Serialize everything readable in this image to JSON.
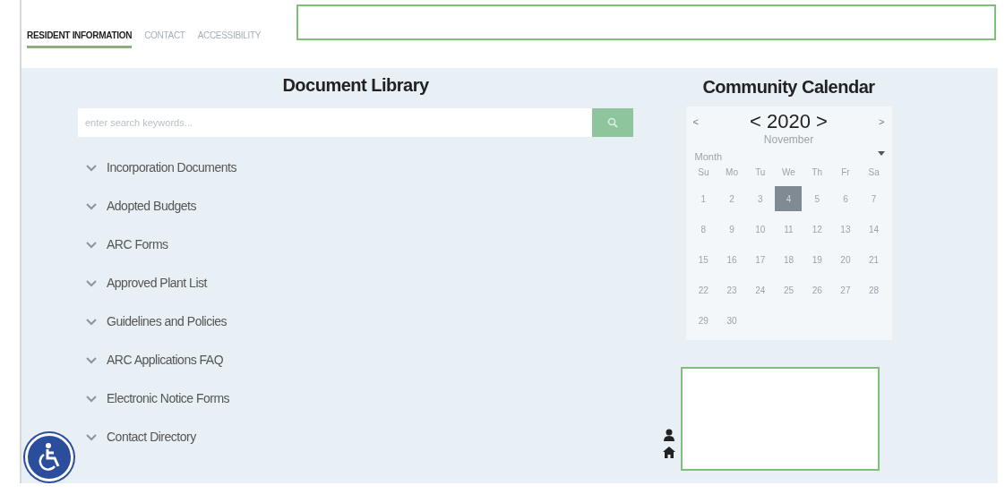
{
  "tabs": [
    {
      "label": "RESIDENT INFORMATION",
      "selected": true
    },
    {
      "label": "CONTACT",
      "selected": false
    },
    {
      "label": "ACCESSIBILITY",
      "selected": false
    }
  ],
  "library": {
    "title": "Document Library",
    "search": {
      "placeholder": "enter search keywords..."
    },
    "items": [
      {
        "label": "Incorporation Documents",
        "expanded": false
      },
      {
        "label": "Adopted Budgets",
        "expanded": false
      },
      {
        "label": "ARC Forms",
        "expanded": false
      },
      {
        "label": "Approved Plant List",
        "expanded": false
      },
      {
        "label": "Guidelines and Policies",
        "expanded": false
      },
      {
        "label": "ARC Applications FAQ",
        "expanded": false
      },
      {
        "label": "Electronic Notice Forms",
        "expanded": false
      },
      {
        "label": "Contact Directory",
        "expanded": false
      }
    ]
  },
  "calendar": {
    "title": "Community Calendar",
    "prev": "<",
    "year": "< 2020 >",
    "next": ">",
    "month": "November",
    "view": "Month",
    "weekdays": [
      "Su",
      "Mo",
      "Tu",
      "We",
      "Th",
      "Fr",
      "Sa"
    ],
    "days": [
      {
        "label": "1",
        "selected": false
      },
      {
        "label": "2",
        "selected": false
      },
      {
        "label": "3",
        "selected": false
      },
      {
        "label": "4",
        "selected": true
      },
      {
        "label": "5",
        "selected": false
      },
      {
        "label": "6",
        "selected": false
      },
      {
        "label": "7",
        "selected": false
      },
      {
        "label": "8",
        "selected": false
      },
      {
        "label": "9",
        "selected": false
      },
      {
        "label": "10",
        "selected": false
      },
      {
        "label": "11",
        "selected": false
      },
      {
        "label": "12",
        "selected": false
      },
      {
        "label": "13",
        "selected": false
      },
      {
        "label": "14",
        "selected": false
      },
      {
        "label": "15",
        "selected": false
      },
      {
        "label": "16",
        "selected": false
      },
      {
        "label": "17",
        "selected": false
      },
      {
        "label": "18",
        "selected": false
      },
      {
        "label": "19",
        "selected": false
      },
      {
        "label": "20",
        "selected": false
      },
      {
        "label": "21",
        "selected": false
      },
      {
        "label": "22",
        "selected": false
      },
      {
        "label": "23",
        "selected": false
      },
      {
        "label": "24",
        "selected": false
      },
      {
        "label": "25",
        "selected": false
      },
      {
        "label": "26",
        "selected": false
      },
      {
        "label": "27",
        "selected": false
      },
      {
        "label": "28",
        "selected": false
      },
      {
        "label": "29",
        "selected": false
      },
      {
        "label": "30",
        "selected": false
      }
    ]
  }
}
